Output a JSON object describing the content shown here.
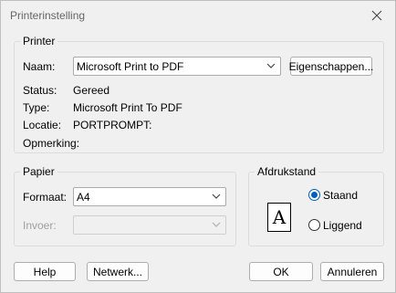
{
  "window": {
    "title": "Printerinstelling"
  },
  "printer": {
    "group_label": "Printer",
    "name_label": "Naam:",
    "name_value": "Microsoft Print to PDF",
    "properties_button": "Eigenschappen...",
    "status_label": "Status:",
    "status_value": "Gereed",
    "type_label": "Type:",
    "type_value": "Microsoft Print To PDF",
    "location_label": "Locatie:",
    "location_value": "PORTPROMPT:",
    "comment_label": "Opmerking:"
  },
  "paper": {
    "group_label": "Papier",
    "format_label": "Formaat:",
    "format_value": "A4",
    "source_label": "Invoer:",
    "source_value": ""
  },
  "orientation": {
    "group_label": "Afdrukstand",
    "portrait_label": "Staand",
    "landscape_label": "Liggend",
    "selected": "portrait",
    "icon_letter": "A"
  },
  "buttons": {
    "help": "Help",
    "network": "Netwerk...",
    "ok": "OK",
    "cancel": "Annuleren"
  },
  "icons": {
    "close": "close-icon",
    "dropdown": "chevron-down-icon"
  },
  "colors": {
    "accent": "#005fb8",
    "background": "#f0f0f0"
  }
}
